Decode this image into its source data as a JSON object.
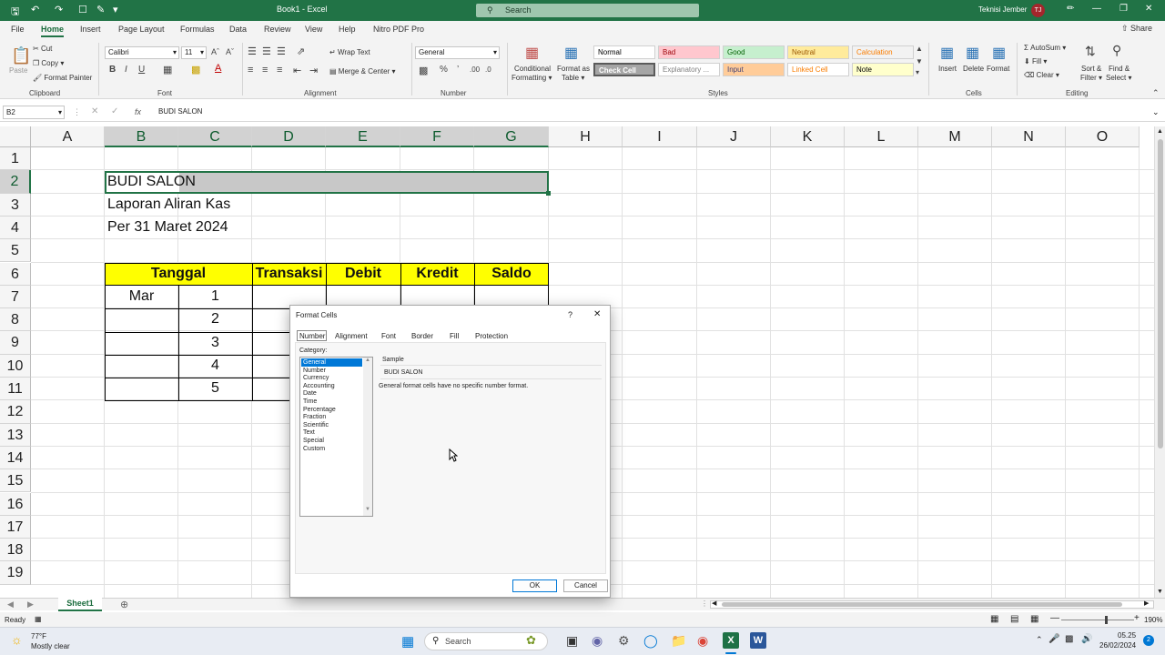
{
  "window": {
    "title": "Book1 - Excel",
    "search_placeholder": "Search",
    "user": "Teknisi Jember",
    "avatar": "TJ"
  },
  "tabs": [
    "File",
    "Home",
    "Insert",
    "Page Layout",
    "Formulas",
    "Data",
    "Review",
    "View",
    "Help",
    "Nitro PDF Pro"
  ],
  "share": "Share",
  "ribbon": {
    "clipboard": {
      "paste": "Paste",
      "cut": "Cut",
      "copy": "Copy",
      "painter": "Format Painter",
      "group": "Clipboard"
    },
    "font": {
      "name": "Calibri",
      "size": "11",
      "group": "Font"
    },
    "alignment": {
      "wrap": "Wrap Text",
      "merge": "Merge & Center",
      "group": "Alignment"
    },
    "number": {
      "format": "General",
      "group": "Number"
    },
    "styles": {
      "cond": "Conditional",
      "cond2": "Formatting",
      "fat": "Format as",
      "fat2": "Table",
      "group": "Styles",
      "items": [
        {
          "label": "Normal",
          "bg": "#ffffff",
          "fg": "#000000"
        },
        {
          "label": "Bad",
          "bg": "#ffc7ce",
          "fg": "#9c0006"
        },
        {
          "label": "Good",
          "bg": "#c6efce",
          "fg": "#006100"
        },
        {
          "label": "Neutral",
          "bg": "#ffeb9c",
          "fg": "#9c5700"
        },
        {
          "label": "Calculation",
          "bg": "#f2f2f2",
          "fg": "#fa7d00"
        },
        {
          "label": "Check Cell",
          "bg": "#a5a5a5",
          "fg": "#ffffff"
        },
        {
          "label": "Explanatory ...",
          "bg": "#ffffff",
          "fg": "#7f7f7f"
        },
        {
          "label": "Input",
          "bg": "#ffcc99",
          "fg": "#3f3f76"
        },
        {
          "label": "Linked Cell",
          "bg": "#ffffff",
          "fg": "#fa7d00"
        },
        {
          "label": "Note",
          "bg": "#ffffcc",
          "fg": "#000000"
        }
      ]
    },
    "cells": {
      "insert": "Insert",
      "delete": "Delete",
      "format": "Format",
      "group": "Cells"
    },
    "editing": {
      "autosum": "AutoSum",
      "fill": "Fill",
      "clear": "Clear",
      "sort": "Sort &",
      "sort2": "Filter",
      "find": "Find &",
      "find2": "Select",
      "group": "Editing"
    }
  },
  "formula_bar": {
    "name_box": "B2",
    "value": "BUDI SALON"
  },
  "columns": [
    "A",
    "B",
    "C",
    "D",
    "E",
    "F",
    "G",
    "H",
    "I",
    "J",
    "K",
    "L",
    "M",
    "N",
    "O"
  ],
  "rows": [
    "1",
    "2",
    "3",
    "4",
    "5",
    "6",
    "7",
    "8",
    "9",
    "10",
    "11",
    "12",
    "13",
    "14",
    "15",
    "16",
    "17",
    "18",
    "19"
  ],
  "sheet": {
    "title": "BUDI SALON",
    "subtitle": "Laporan Aliran Kas",
    "date": "Per 31 Maret 2024",
    "headers": [
      "Tanggal",
      "Transaksi",
      "Debit",
      "Kredit",
      "Saldo"
    ],
    "month": "Mar",
    "days": [
      "1",
      "2",
      "3",
      "4",
      "5"
    ]
  },
  "sheet_tab": "Sheet1",
  "status": {
    "ready": "Ready",
    "zoom": "190%"
  },
  "taskbar": {
    "weather_temp": "77°F",
    "weather_desc": "Mostly clear",
    "search": "Search",
    "time": "05.25",
    "date": "26/02/2024"
  },
  "dialog": {
    "title": "Format Cells",
    "help": "?",
    "tabs": [
      "Number",
      "Alignment",
      "Font",
      "Border",
      "Fill",
      "Protection"
    ],
    "category_label": "Category:",
    "categories": [
      "General",
      "Number",
      "Currency",
      "Accounting",
      "Date",
      "Time",
      "Percentage",
      "Fraction",
      "Scientific",
      "Text",
      "Special",
      "Custom"
    ],
    "sample_label": "Sample",
    "sample_value": "BUDI SALON",
    "description": "General format cells have no specific number format.",
    "ok": "OK",
    "cancel": "Cancel"
  }
}
